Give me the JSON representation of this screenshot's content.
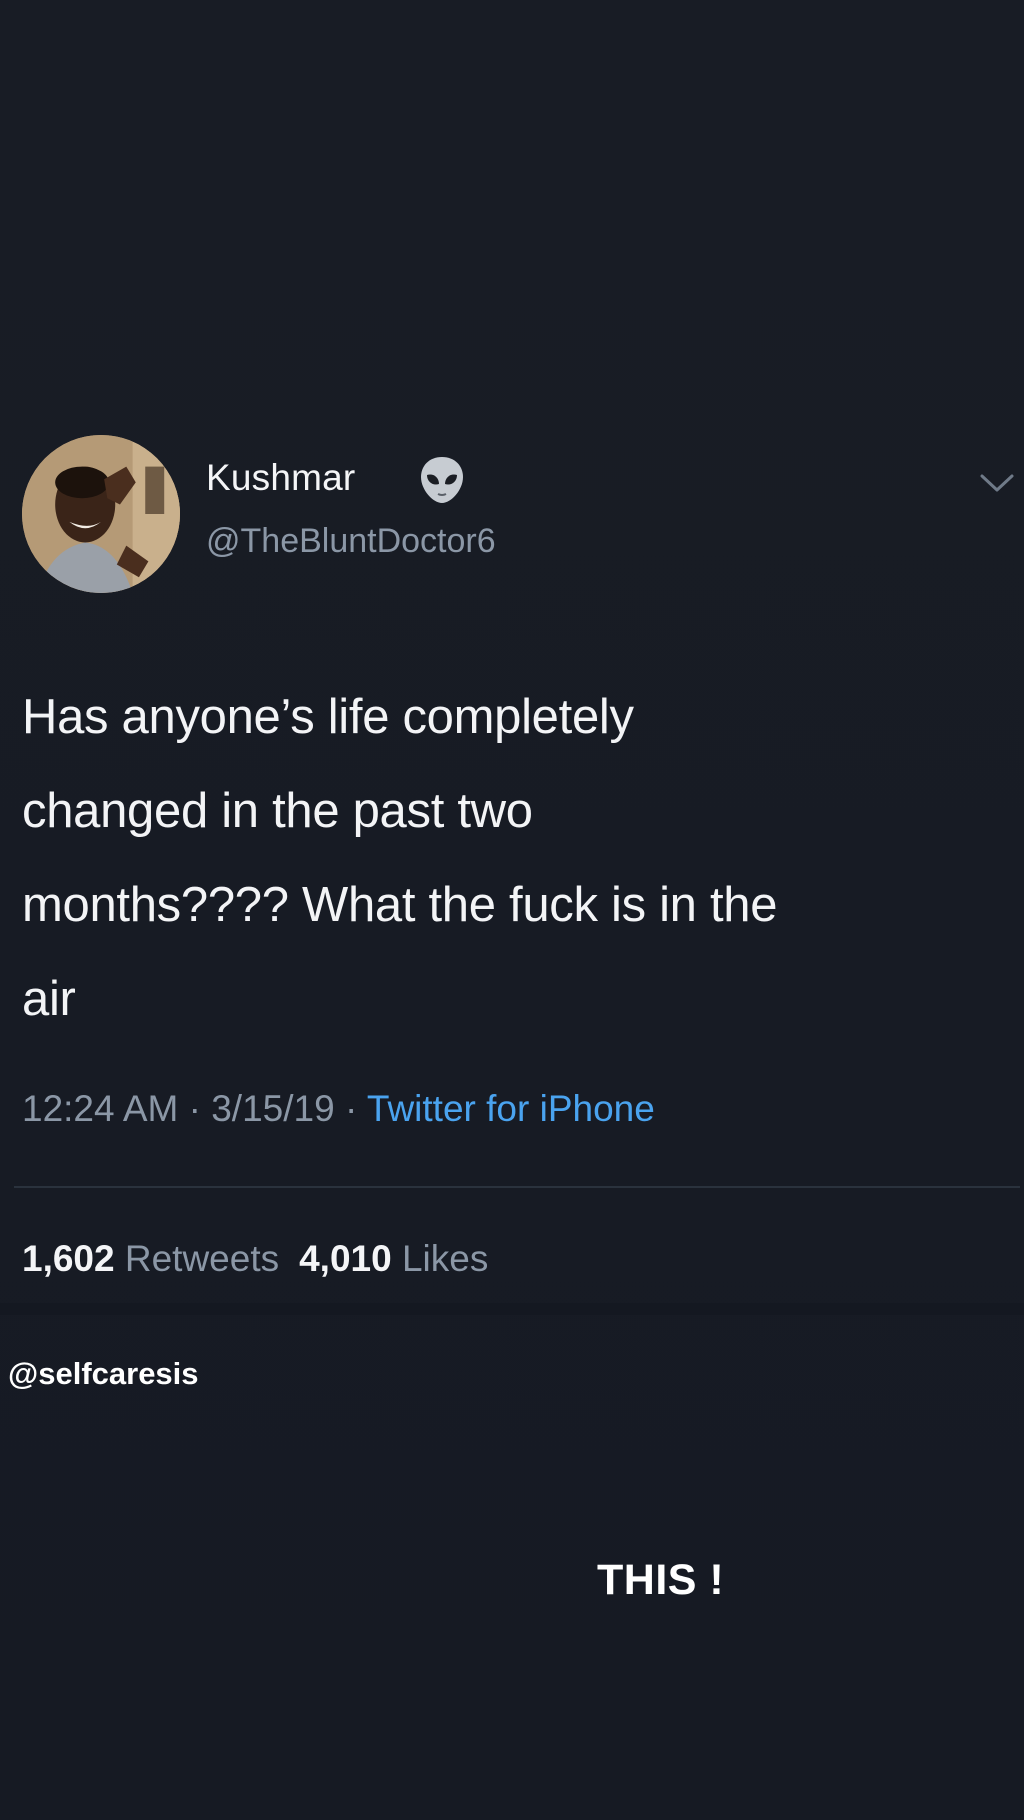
{
  "tweet": {
    "display_name": "Kushmar",
    "name_emoji_icon": "alien-emoji-icon",
    "handle": "@TheBluntDoctor6",
    "text": "Has anyone’s life completely\nchanged in the past two\nmonths???? What the fuck is in the\nair",
    "time": "12:24 AM",
    "date": "3/15/19",
    "separator": " · ",
    "source": "Twitter for iPhone",
    "retweets_count": "1,602",
    "retweets_label": "Retweets",
    "likes_count": "4,010",
    "likes_label": "Likes",
    "menu_icon": "chevron-down-icon"
  },
  "overlay": {
    "credit": "@selfcaresis",
    "caption": "THIS !"
  },
  "colors": {
    "background": "#171b24",
    "text_primary": "#f3f4f6",
    "text_secondary": "#8b97a6",
    "link": "#4aa3ef",
    "divider": "#2a323d"
  }
}
